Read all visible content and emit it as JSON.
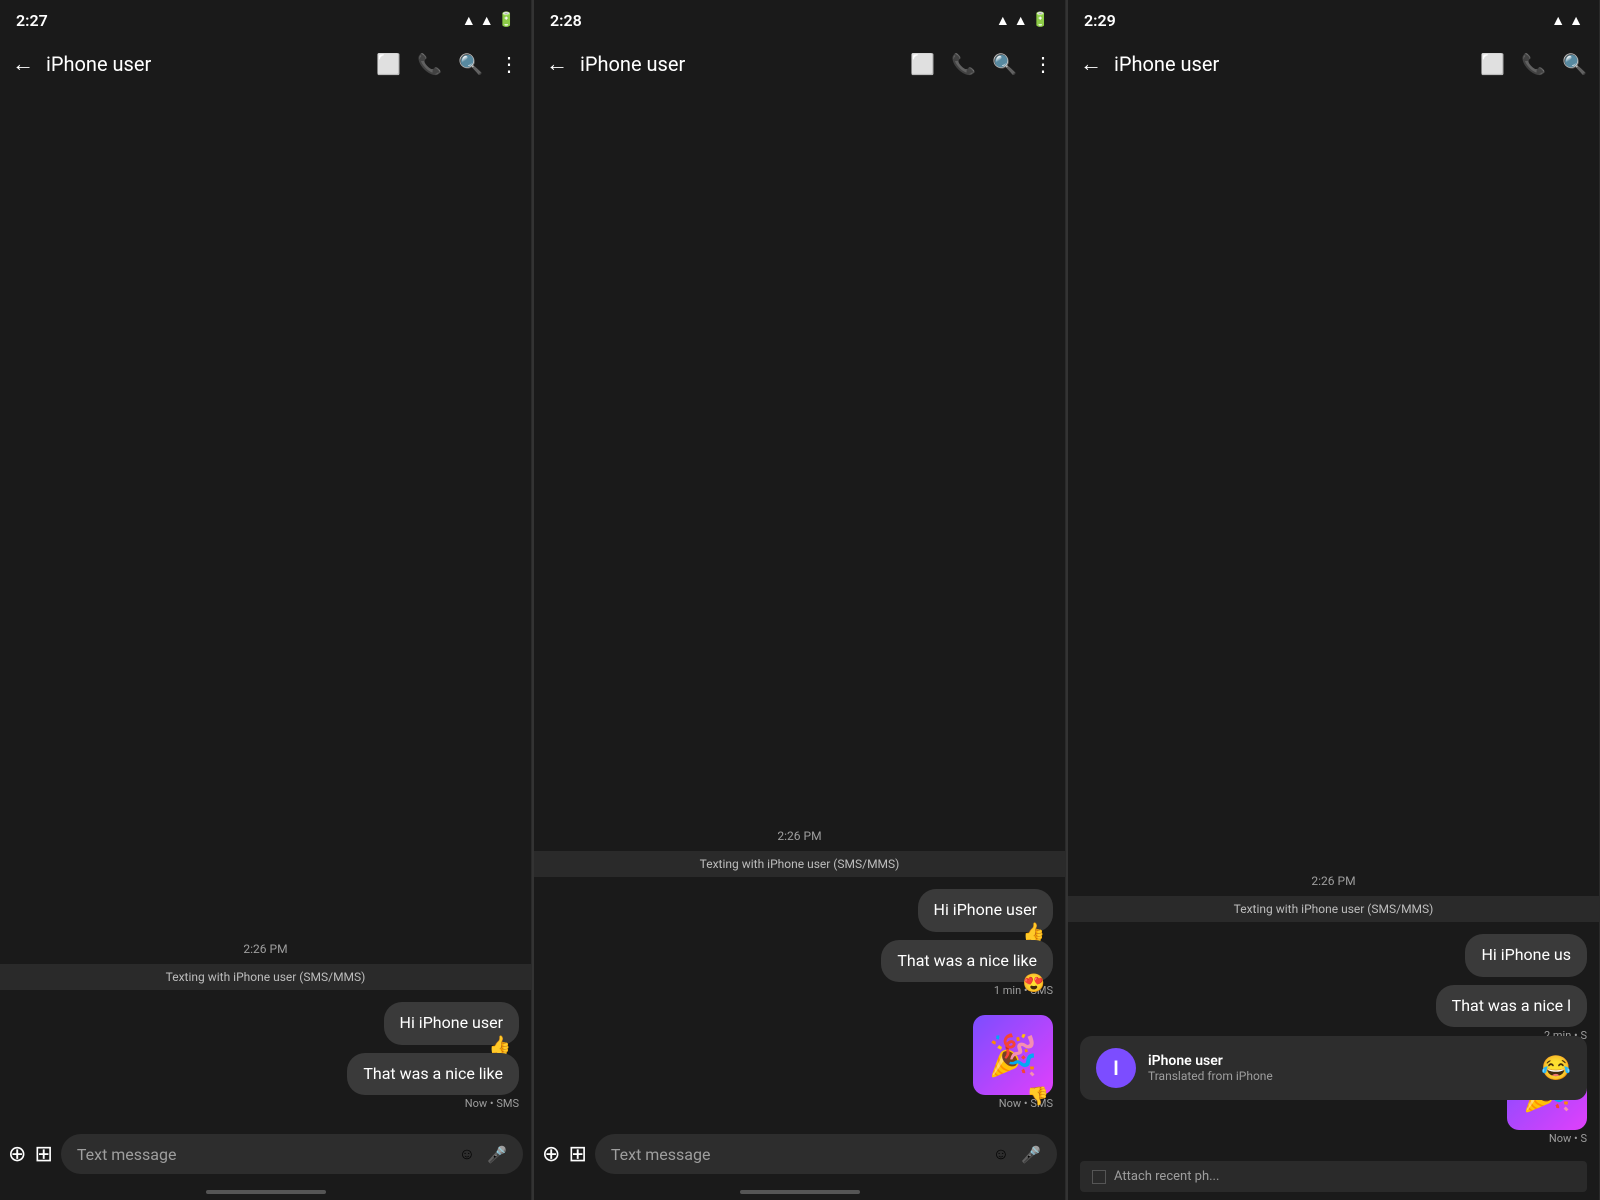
{
  "panels": [
    {
      "id": "panel1",
      "status_time": "2:27",
      "contact_name": "iPhone user",
      "timestamp_label": "2:26 PM",
      "session_label": "Texting with iPhone user (SMS/MMS)",
      "messages": [
        {
          "text": "Hi iPhone user",
          "reaction": "👍",
          "meta": ""
        },
        {
          "text": "That was a nice like",
          "reaction": "",
          "meta": "Now • SMS"
        }
      ],
      "input_placeholder": "Text message"
    },
    {
      "id": "panel2",
      "status_time": "2:28",
      "contact_name": "iPhone user",
      "timestamp_label": "2:26 PM",
      "session_label": "Texting with iPhone user (SMS/MMS)",
      "messages": [
        {
          "text": "Hi iPhone user",
          "reaction": "👍",
          "meta": ""
        },
        {
          "text": "That was a nice like",
          "reaction": "😍",
          "meta": "1 min • SMS"
        }
      ],
      "image_message": {
        "emoji": "🎉",
        "reaction": "👎",
        "meta": "Now • SMS"
      },
      "input_placeholder": "Text message"
    },
    {
      "id": "panel3",
      "status_time": "2:29",
      "contact_name": "iPhone user",
      "timestamp_label": "2:26 PM",
      "session_label": "Texting with iPhone user (SMS/MMS)",
      "messages": [
        {
          "text": "Hi iPhone us",
          "reaction": "",
          "meta": "",
          "truncated": true
        },
        {
          "text": "That was a nice l",
          "reaction": "",
          "meta": "2 min • S",
          "truncated": true
        }
      ],
      "image_message": {
        "emoji": "🎉",
        "reaction": "",
        "meta": "Now • S",
        "truncated": true
      },
      "attach_bar": "Attach recent ph...",
      "notification": {
        "avatar_letter": "I",
        "title": "iPhone user",
        "subtitle": "Translated from iPhone",
        "emoji": "😂"
      }
    }
  ],
  "icons": {
    "back": "←",
    "video_call": "□↗",
    "phone": "📞",
    "search": "🔍",
    "more": "⋮",
    "add": "＋",
    "gallery": "⊞",
    "emoji": "☺",
    "mic": "🎤"
  }
}
